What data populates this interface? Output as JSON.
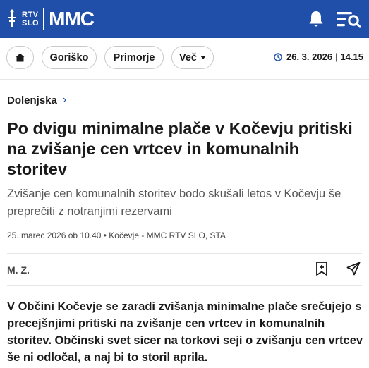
{
  "header": {
    "logo_small": [
      "RTV",
      "SLO"
    ],
    "logo_main": "MMC",
    "bell_icon": "bell-icon",
    "menu_search_icon": "menu-search-icon",
    "colors": {
      "brand": "#1f4fa8"
    }
  },
  "nav": {
    "home_icon": "home-icon",
    "items": [
      "Goriško",
      "Primorje",
      "Več"
    ],
    "date": "26. 3. 2026",
    "time": "14.15"
  },
  "article": {
    "category": "Dolenjska",
    "title": "Po dvigu minimalne plače v Kočevju pritiski na zvišanje cen vrtcev in komunalnih storitev",
    "lead": "Zvišanje cen komunalnih storitev bodo skušali letos v Kočevju še preprečiti z notranjimi rezervami",
    "meta": "25. marec 2026 ob 10.40 • Kočevje - MMC RTV SLO, STA",
    "author": "M. Z.",
    "body": "V Občini Kočevje se zaradi zvišanja minimalne plače srečujejo s precejšnjimi pritiski na zvišanje cen vrtcev in komunalnih storitev. Občinski svet sicer na torkovi seji o zvišanju cen vrtcev še ni odločal, a naj bi to storil aprila."
  }
}
